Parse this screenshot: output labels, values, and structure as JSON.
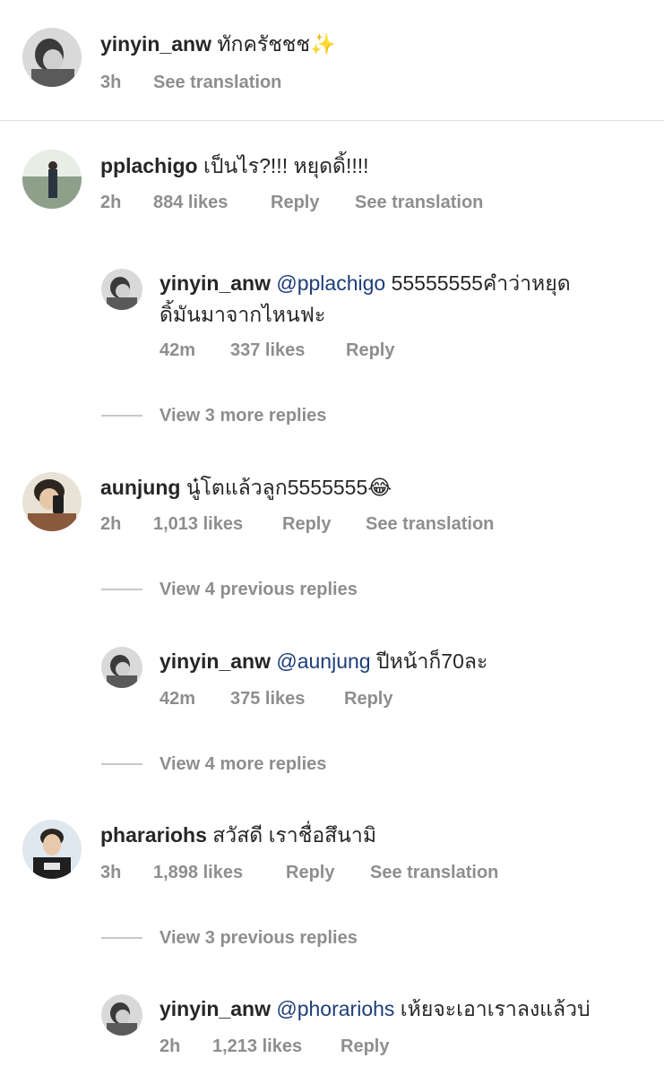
{
  "comments": [
    {
      "username": "yinyin_anw",
      "text": "ทักครัชชช",
      "emoji": "✨",
      "time": "3h",
      "see_translation": "See translation"
    },
    {
      "username": "pplachigo",
      "text": "เป็นไร?!!! หยุดดิ้!!!!",
      "time": "2h",
      "likes": "884 likes",
      "reply": "Reply",
      "see_translation": "See translation",
      "replies": [
        {
          "username": "yinyin_anw",
          "mention": "@pplachigo",
          "text_line1": "55555555คำว่าหยุด",
          "text_line2": "ดิ้มันมาจากไหนฟะ",
          "time": "42m",
          "likes": "337 likes",
          "reply": "Reply"
        }
      ],
      "view_more": "View 3 more replies"
    },
    {
      "username": "aunjung",
      "text": "นู๋โตแล้วลูก5555555",
      "emoji": "😂",
      "time": "2h",
      "likes": "1,013 likes",
      "reply": "Reply",
      "see_translation": "See translation",
      "view_previous": "View 4 previous replies",
      "replies": [
        {
          "username": "yinyin_anw",
          "mention": "@aunjung",
          "text": "ปีหน้าก็70ละ",
          "time": "42m",
          "likes": "375 likes",
          "reply": "Reply"
        }
      ],
      "view_more": "View 4 more replies"
    },
    {
      "username": "pharariohs",
      "text": "สวัสดี เราชื่อสึนามิ",
      "time": "3h",
      "likes": "1,898 likes",
      "reply": "Reply",
      "see_translation": "See translation",
      "view_previous": "View 3 previous replies",
      "replies": [
        {
          "username": "yinyin_anw",
          "mention": "@phorariohs",
          "text": "เห้ยจะเอาเราลงแล้วบ่",
          "time": "2h",
          "likes": "1,213 likes",
          "reply": "Reply"
        }
      ]
    }
  ],
  "colors": {
    "text": "#262626",
    "meta": "#8e8e8e",
    "mention": "#1d3e79",
    "divider": "#dbdbdb"
  }
}
